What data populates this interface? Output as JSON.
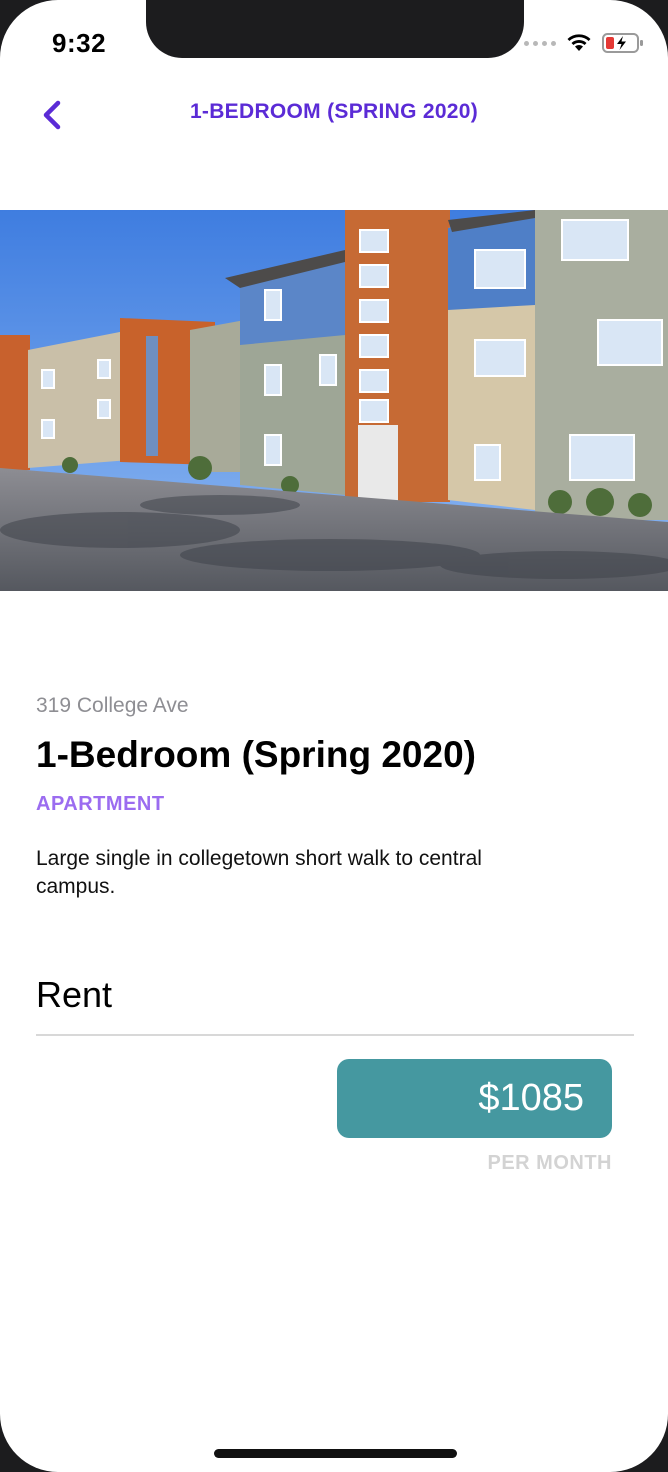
{
  "status_bar": {
    "time": "9:32",
    "icons": [
      "cellular-signal-icon",
      "wifi-icon",
      "battery-charging-icon"
    ],
    "battery_color": "#e53935"
  },
  "nav": {
    "title": "1-BEDROOM (SPRING 2020)",
    "back_icon": "chevron-left-icon",
    "accent_color": "#5b2bd6"
  },
  "listing": {
    "address": "319 College Ave",
    "title": "1-Bedroom (Spring 2020)",
    "type": "APARTMENT",
    "description": "Large single in collegetown short walk to central campus."
  },
  "rent": {
    "heading": "Rent",
    "price": "$1085",
    "period": "PER MONTH",
    "pill_color": "#4598a0"
  }
}
